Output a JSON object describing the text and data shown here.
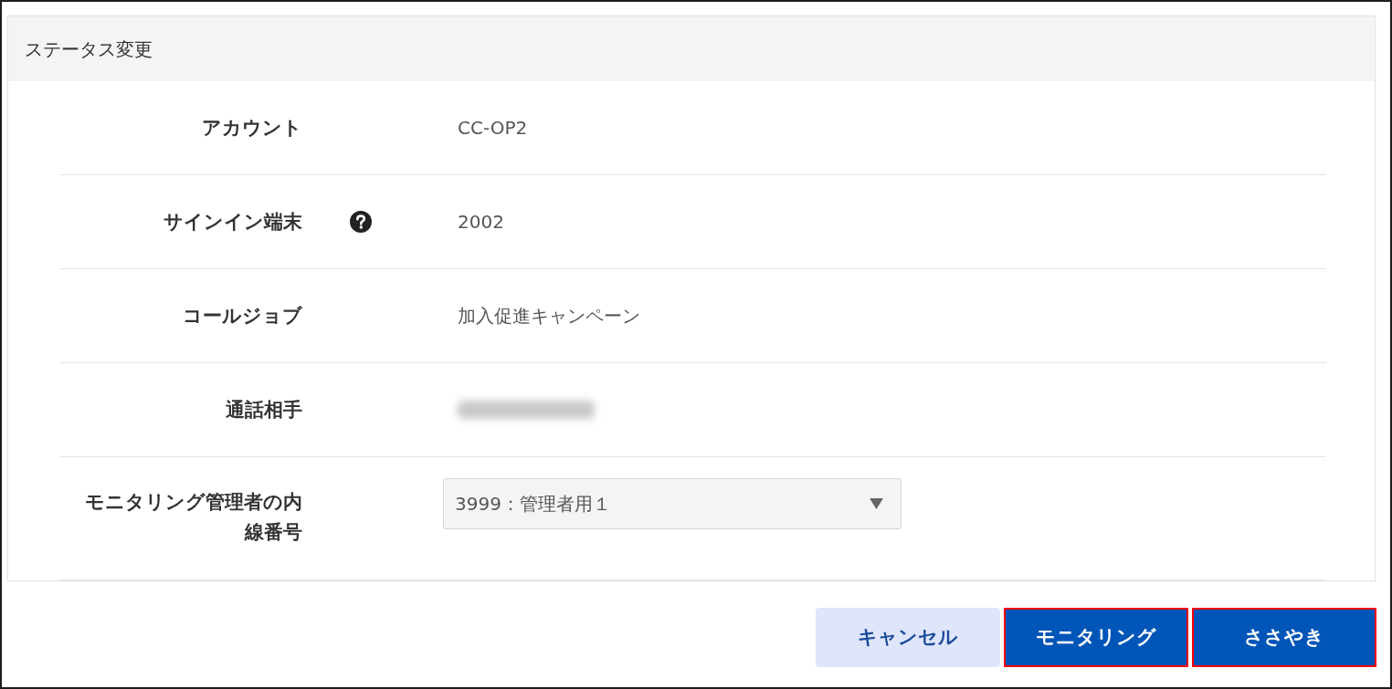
{
  "panel": {
    "title": "ステータス変更",
    "rows": [
      {
        "kind": "text",
        "label": "アカウント",
        "value": "CC-OP2",
        "help": false
      },
      {
        "kind": "text",
        "label": "サインイン端末",
        "value": "2002",
        "help": true
      },
      {
        "kind": "text",
        "label": "コールジョブ",
        "value": "加入促進キャンペーン",
        "help": false
      },
      {
        "kind": "redacted",
        "label": "通話相手",
        "help": false
      },
      {
        "kind": "select",
        "label": "モニタリング管理者の内線番号",
        "value": "3999：管理者用１",
        "help": false
      }
    ]
  },
  "buttons": [
    {
      "label": "キャンセル",
      "kind": "secondary",
      "highlighted": false
    },
    {
      "label": "モニタリング",
      "kind": "primary",
      "highlighted": true
    },
    {
      "label": "ささやき",
      "kind": "primary",
      "highlighted": true
    }
  ]
}
